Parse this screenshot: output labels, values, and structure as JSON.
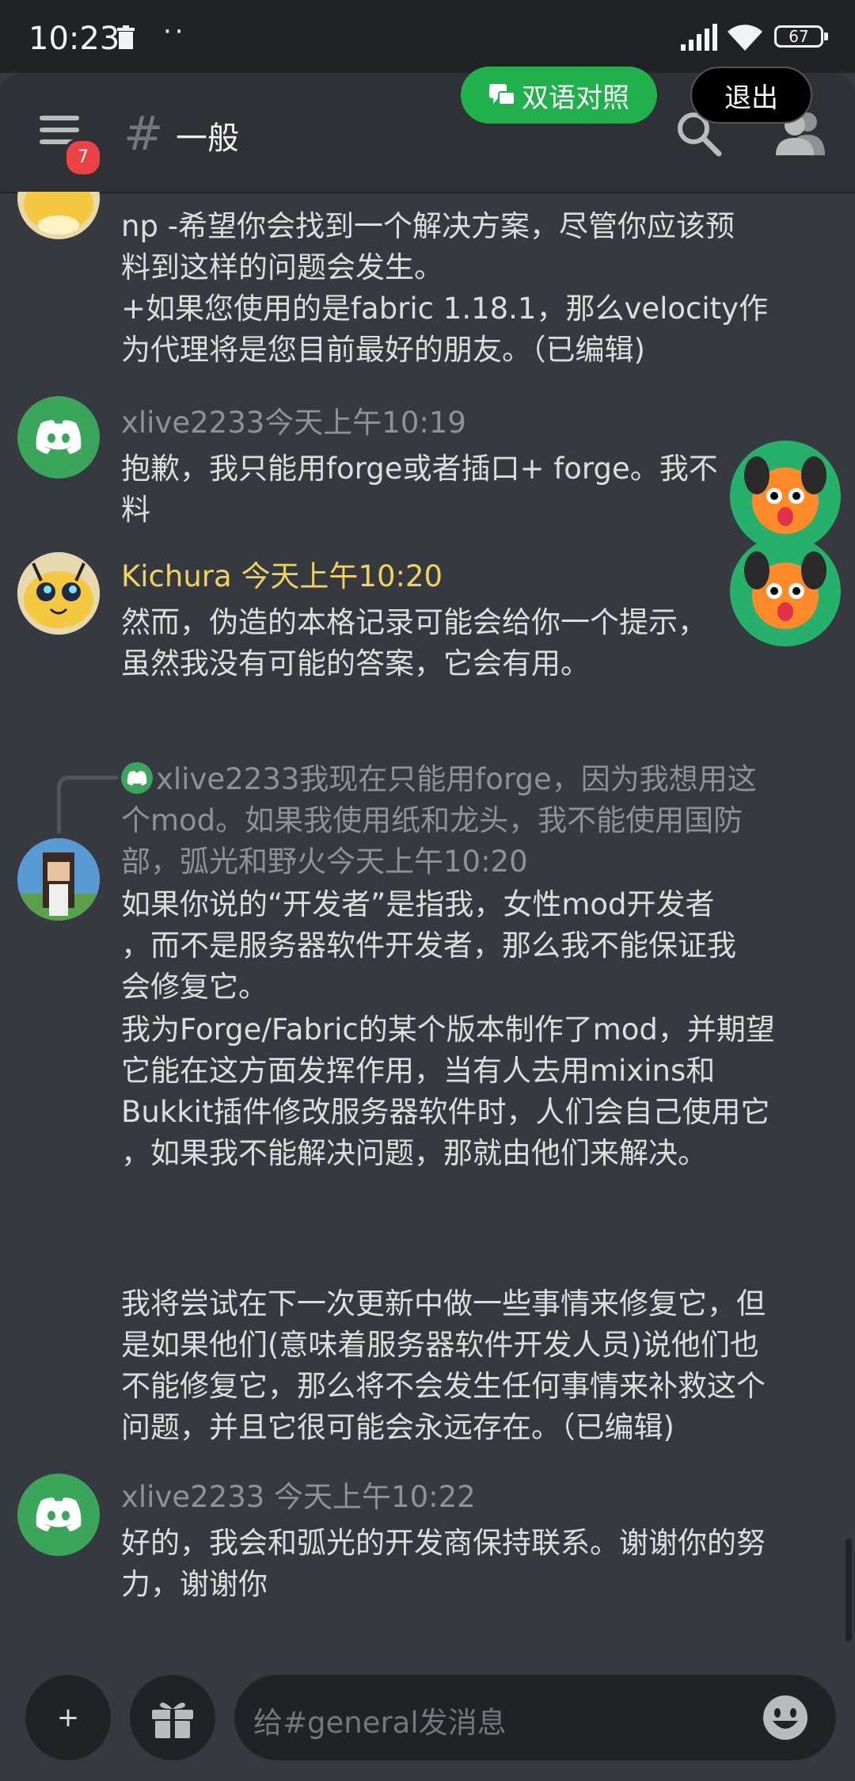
{
  "status_bar": {
    "time": "10:23",
    "dots": "··",
    "battery": "67"
  },
  "header": {
    "channel_hash": "#",
    "channel_name": "一般",
    "notification_badge": "7",
    "bilingual_button": "双语对照",
    "exit_button": "退出"
  },
  "messages": [
    {
      "id": "m1",
      "lines": [
        "np -希望你会找到一个解决方案，尽管你应该预",
        "料到这样的问题会发生。",
        "+如果您使用的是fabric 1.18.1，那么velocity作",
        "为代理将是您目前最好的朋友。（已编辑)"
      ]
    },
    {
      "id": "m2",
      "username": "xlive2233",
      "timestamp": "今天上午10:19",
      "lines": [
        "抱歉，我只能用forge或者插口+ forge。我不",
        "料"
      ]
    },
    {
      "id": "m3",
      "username": "Kichura ",
      "timestamp": "今天上午10:20",
      "lines": [
        "然而，伪造的本格记录可能会给你一个提示，",
        "虽然我没有可能的答案，它会有用。"
      ]
    },
    {
      "id": "m4",
      "reply_lines": [
        "xlive2233我现在只能用forge，因为我想用这",
        "个mod。如果我使用纸和龙头，我不能使用国防",
        "部，弧光和野火今天上午10:20"
      ],
      "para1": [
        "如果你说的“开发者”是指我，女性mod开发者",
        "，而不是服务器软件开发者，那么我不能保证我",
        "会修复它。"
      ],
      "para2": [
        "我为Forge/Fabric的某个版本制作了mod，并期望",
        "它能在这方面发挥作用，当有人去用mixins和",
        "Bukkit插件修改服务器软件时，人们会自己使用它",
        "，如果我不能解决问题，那就由他们来解决。"
      ],
      "para3": [
        "我将尝试在下一次更新中做一些事情来修复它，但",
        "是如果他们(意味着服务器软件开发人员)说他们也",
        "不能修复它，那么将不会发生任何事情来补救这个",
        "问题，并且它很可能会永远存在。（已编辑)"
      ]
    },
    {
      "id": "m5",
      "username": "xlive2233 ",
      "timestamp": "今天上午10:22",
      "lines": [
        "好的，我会和弧光的开发商保持联系。谢谢你的努",
        "力，谢谢你"
      ]
    }
  ],
  "composer": {
    "plus": "+",
    "placeholder": "给#general发消息"
  },
  "icons": [
    "hamburger-icon",
    "search-icon",
    "members-icon",
    "discord-logo-icon",
    "gift-icon",
    "emoji-icon",
    "translate-icon"
  ],
  "colors": {
    "discord_green": "#3ba55c",
    "badge_red": "#ed4245",
    "bilingual_green": "#22b04c",
    "username_yellow": "#f0d35a"
  }
}
